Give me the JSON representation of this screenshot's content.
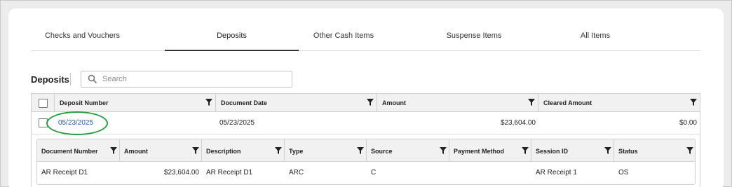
{
  "tabs": [
    {
      "label": "Checks and Vouchers",
      "active": false
    },
    {
      "label": "Deposits",
      "active": true
    },
    {
      "label": "Other Cash Items",
      "active": false
    },
    {
      "label": "Suspense Items",
      "active": false
    },
    {
      "label": "All Items",
      "active": false
    }
  ],
  "section": {
    "title": "Deposits"
  },
  "search": {
    "placeholder": "Search",
    "value": ""
  },
  "grid": {
    "columns": [
      "Deposit Number",
      "Document Date",
      "Amount",
      "Cleared Amount"
    ],
    "rows": [
      {
        "deposit_number": "05/23/2025",
        "document_date": "05/23/2025",
        "amount": "$23,604.00",
        "cleared_amount": "$0.00"
      }
    ]
  },
  "detail_grid": {
    "columns": [
      "Document Number",
      "Amount",
      "Description",
      "Type",
      "Source",
      "Payment Method",
      "Session ID",
      "Status"
    ],
    "rows": [
      {
        "document_number": "AR Receipt D1",
        "amount": "$23,604.00",
        "description": "AR Receipt D1",
        "type": "ARC",
        "source": "C",
        "payment_method": "",
        "session_id": "AR Receipt 1",
        "status": "OS"
      }
    ]
  },
  "colors": {
    "link": "#1f5fa6",
    "highlight": "#22a03c",
    "header_bg": "#f1f1f1"
  },
  "icons": {
    "search": "search-icon",
    "filter": "filter-icon"
  }
}
